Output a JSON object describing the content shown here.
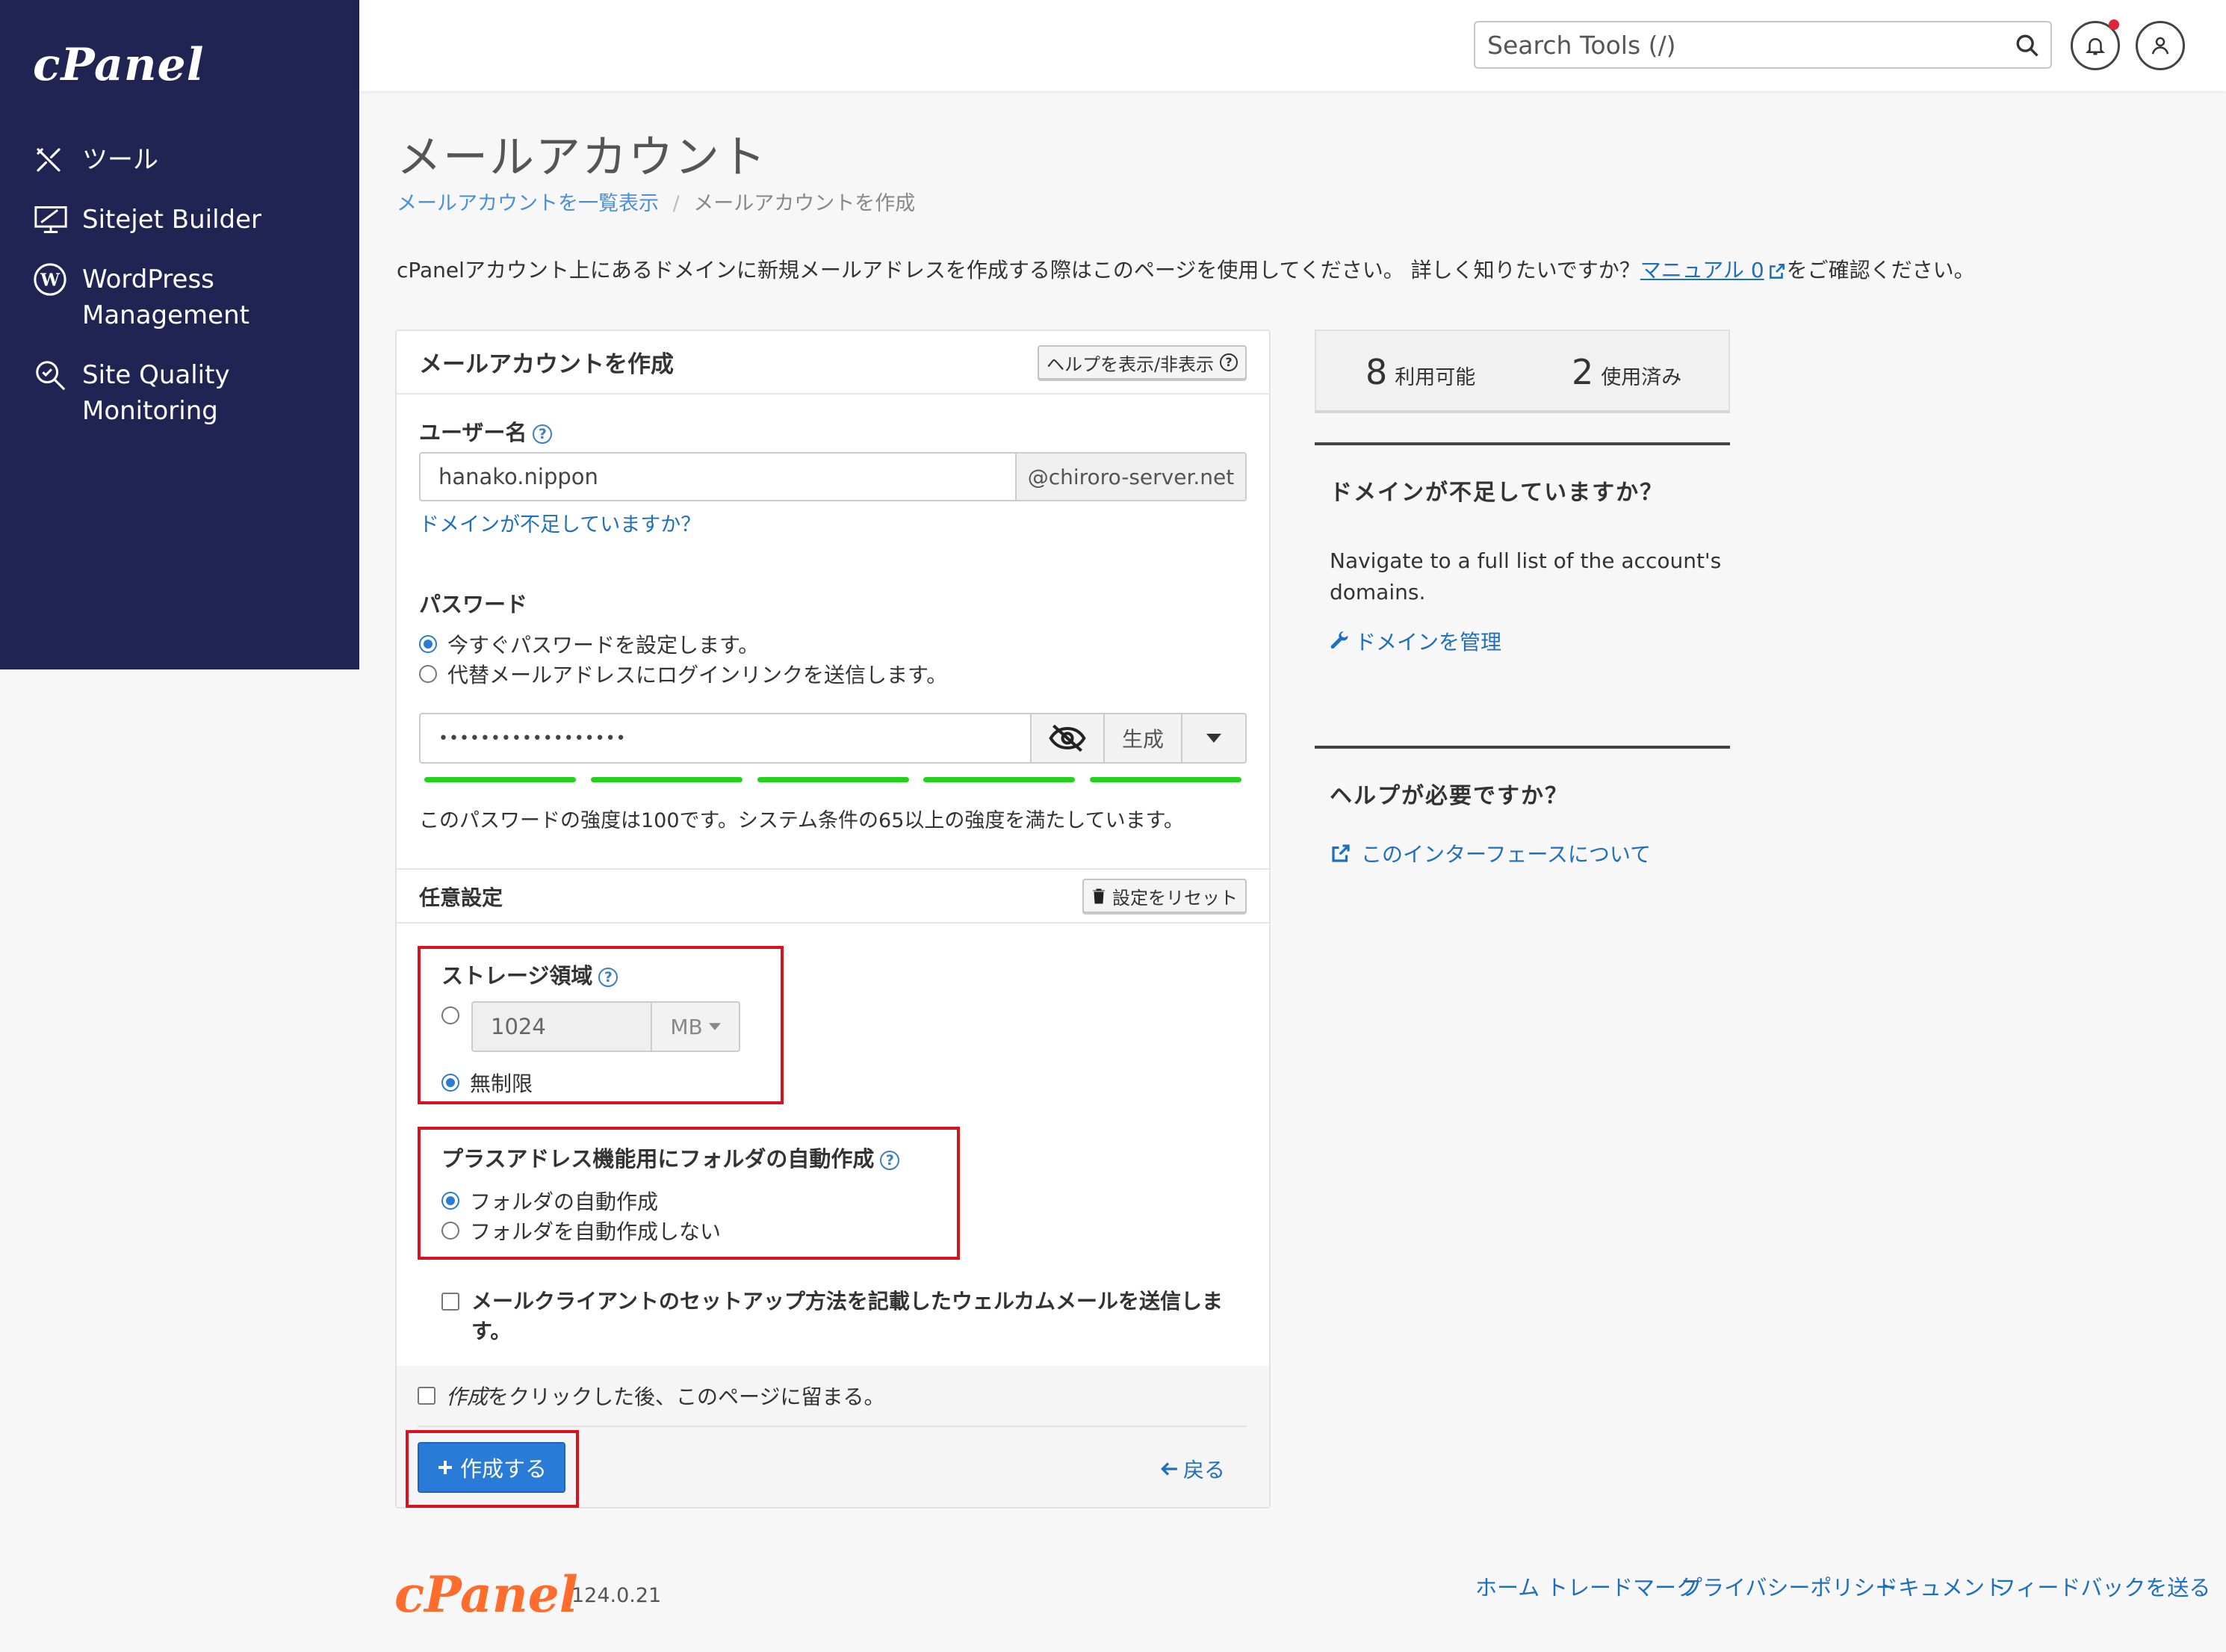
{
  "app": {
    "brand": "cPanel",
    "version": "124.0.21"
  },
  "sidebar": {
    "items": [
      {
        "label": "ツール",
        "icon": "tools-icon"
      },
      {
        "label": "Sitejet Builder",
        "icon": "monitor-design-icon"
      },
      {
        "label": "WordPress\nManagement",
        "icon": "wordpress-icon"
      },
      {
        "label": "Site Quality\nMonitoring",
        "icon": "magnifier-icon"
      }
    ]
  },
  "header": {
    "search_placeholder": "Search Tools (/)"
  },
  "page": {
    "title": "メールアカウント",
    "breadcrumb": {
      "parent": "メールアカウントを一覧表示",
      "sep": "/",
      "current": "メールアカウントを作成"
    },
    "intro_before": "cPanelアカウント上にあるドメインに新規メールアドレスを作成する際はこのページを使用してください。 詳しく知りたいですか？",
    "intro_link": "マニュアル 0",
    "intro_after": "をご確認ください。"
  },
  "form": {
    "title": "メールアカウントを作成",
    "help_toggle": "ヘルプを表示/非表示",
    "username_label": "ユーザー名",
    "username_value": "hanako.nippon",
    "domain": "@chiroro-server.net",
    "domain_link": "ドメインが不足していますか？",
    "password_label": "パスワード",
    "pw_option_now": "今すぐパスワードを設定します。",
    "pw_option_link": "代替メールアドレスにログインリンクを送信します。",
    "password_mask": "••••••••••••••••••",
    "generate": "生成",
    "strength_text": "このパスワードの強度は100です。システム条件の65以上の強度を満たしています。",
    "strength": 100,
    "optional_label": "任意設定",
    "reset_label": "設定をリセット",
    "storage_label": "ストレージ領域",
    "storage_value": "1024",
    "storage_unit": "MB",
    "unlimited": "無制限",
    "plus_label": "プラスアドレス機能用にフォルダの自動作成",
    "plus_auto": "フォルダの自動作成",
    "plus_no": "フォルダを自動作成しない",
    "welcome_line1": "メールクライアントのセットアップ方法を記載したウェルカムメールを送信しま",
    "welcome_line2": "す。",
    "stay_em": "作成",
    "stay_rest": "をクリックした後、このページに留まる。",
    "create": "作成する",
    "back": "戻る"
  },
  "stats": {
    "available_num": "8",
    "available_label": "利用可能",
    "used_num": "2",
    "used_label": "使用済み"
  },
  "domains_panel": {
    "title": "ドメインが不足していますか？",
    "text_line1": "Navigate to a full list of the account's",
    "text_line2": "domains.",
    "link": "ドメインを管理"
  },
  "help_panel": {
    "title": "ヘルプが必要ですか？",
    "link": "このインターフェースについて"
  },
  "footer": {
    "links": [
      "ホーム",
      "トレードマーク",
      "プライバシーポリシー",
      "ドキュメント",
      "フィードバックを送る"
    ]
  },
  "colors": {
    "sidebar_bg": "#1f2452",
    "link": "#1f6fbf",
    "primary_button": "#2a7bd8",
    "strength": "#22d31c",
    "highlight": "#d9121f",
    "footer_logo": "#ff6c2c"
  }
}
